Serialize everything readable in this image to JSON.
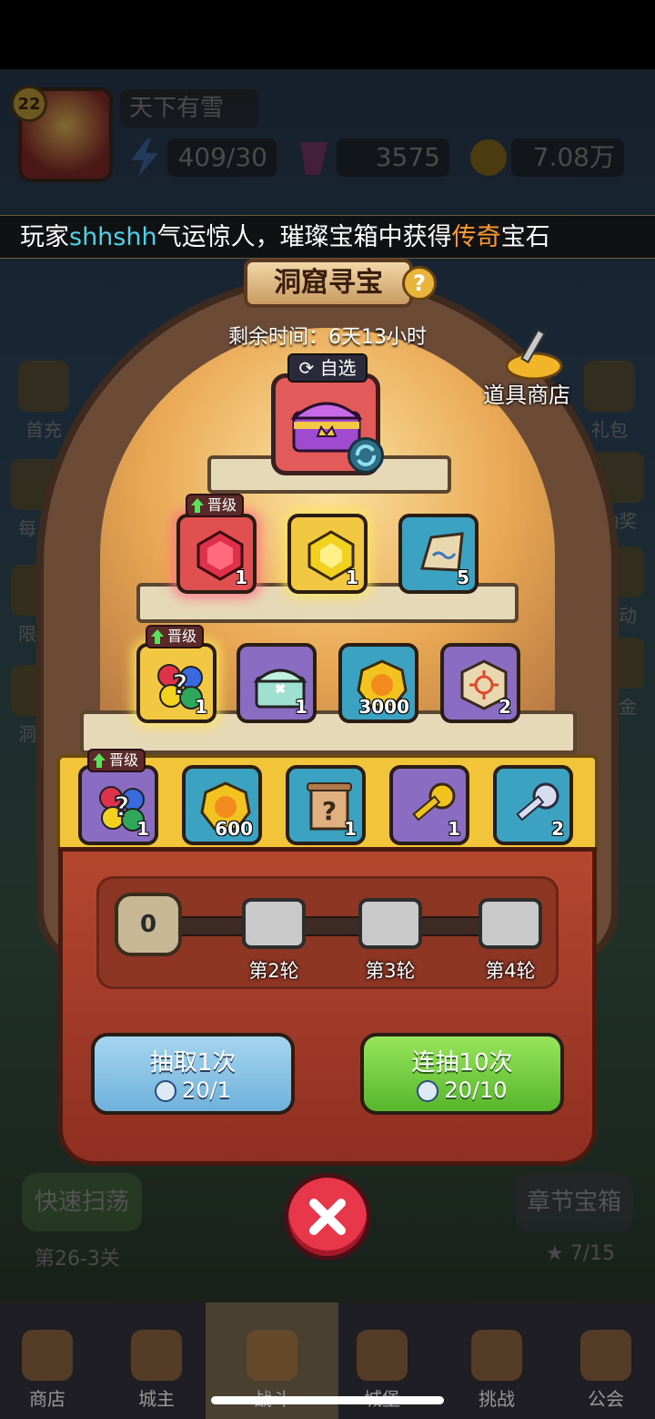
{
  "hud": {
    "level": "22",
    "player_name": "天下有雪",
    "energy": "409/30",
    "gems": "3575",
    "gold": "7.08万"
  },
  "marquee": {
    "prefix": "玩家",
    "player": "shhshh",
    "mid": "气运惊人，璀璨宝箱中获得",
    "rarity": "传奇",
    "suffix": "宝石"
  },
  "side_menu": {
    "left": [
      "首充",
      "每日",
      "限时",
      "洞窟"
    ],
    "right": [
      "礼包",
      "抽奖",
      "活动",
      "基金"
    ]
  },
  "event": {
    "title": "洞窟寻宝",
    "timer": "剩余时间：6天13小时",
    "shop_label": "道具商店",
    "top_reward_badge": "自选",
    "upgrade_label": "晋级"
  },
  "rewards": {
    "row1": [
      {
        "icon": "ruby-gem-icon",
        "count": "1",
        "upgrade": true
      },
      {
        "icon": "topaz-gem-icon",
        "count": "1",
        "upgrade": false
      },
      {
        "icon": "scroll-stone-icon",
        "count": "5",
        "upgrade": false
      }
    ],
    "row2": [
      {
        "icon": "random-gem-bag-icon",
        "count": "1",
        "upgrade": true
      },
      {
        "icon": "silver-chest-icon",
        "count": "1",
        "upgrade": false
      },
      {
        "icon": "gold-coin-icon",
        "count": "3000",
        "upgrade": false
      },
      {
        "icon": "rune-stone-icon",
        "count": "2",
        "upgrade": false
      }
    ],
    "row3": [
      {
        "icon": "random-gem-bag-icon",
        "count": "1",
        "upgrade": true
      },
      {
        "icon": "gold-coin-icon",
        "count": "600",
        "upgrade": false
      },
      {
        "icon": "mystery-scroll-icon",
        "count": "1",
        "upgrade": false
      },
      {
        "icon": "gold-key-icon",
        "count": "1",
        "upgrade": false
      },
      {
        "icon": "silver-key-icon",
        "count": "2",
        "upgrade": false
      }
    ]
  },
  "progress": {
    "current": "0",
    "milestones": [
      "第2轮",
      "第3轮",
      "第4轮"
    ]
  },
  "buttons": {
    "draw_one": {
      "label": "抽取1次",
      "cost": "20/1"
    },
    "draw_ten": {
      "label": "连抽10次",
      "cost": "20/10"
    }
  },
  "background": {
    "quick_sweep": "快速扫荡",
    "stage": "第26-3关",
    "chapter_chest": "章节宝箱",
    "stars": "7/15"
  },
  "nav": [
    "商店",
    "城主",
    "战斗",
    "城堡",
    "挑战",
    "公会"
  ],
  "colors": {
    "highlight_player": "#4fd2e8",
    "highlight_rarity": "#ff9a2e",
    "draw_one_button": "#6fb1dc",
    "draw_ten_button": "#57b62c",
    "close_button": "#e8374a"
  }
}
